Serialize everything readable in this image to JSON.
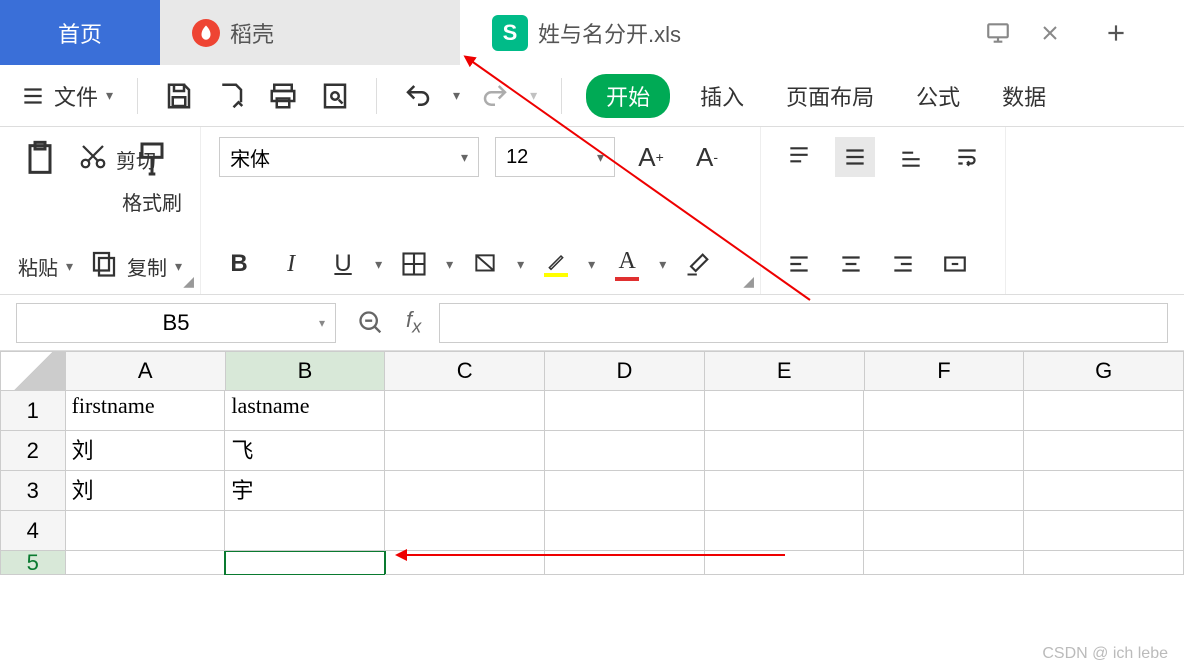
{
  "tabs": {
    "home": "首页",
    "daoke": "稻壳",
    "file": "姓与名分开.xls"
  },
  "file_menu": "文件",
  "ribbon": {
    "start": "开始",
    "insert": "插入",
    "layout": "页面布局",
    "formula": "公式",
    "data": "数据"
  },
  "clipboard": {
    "paste": "粘贴",
    "cut": "剪切",
    "copy": "复制",
    "format_painter": "格式刷"
  },
  "font": {
    "name": "宋体",
    "size": "12",
    "bold": "B",
    "italic": "I",
    "underline": "U",
    "highlight_color": "#ffff00",
    "font_color": "#e03030"
  },
  "namebox": "B5",
  "columns": [
    "A",
    "B",
    "C",
    "D",
    "E",
    "F",
    "G"
  ],
  "rows": [
    "1",
    "2",
    "3",
    "4",
    "5"
  ],
  "active_cell": "B5",
  "data": {
    "A1": "firstname",
    "B1": "lastname",
    "A2": "刘",
    "B2": "飞",
    "A3": "刘",
    "B3": "宇"
  },
  "watermark": "CSDN @ ich lebe"
}
